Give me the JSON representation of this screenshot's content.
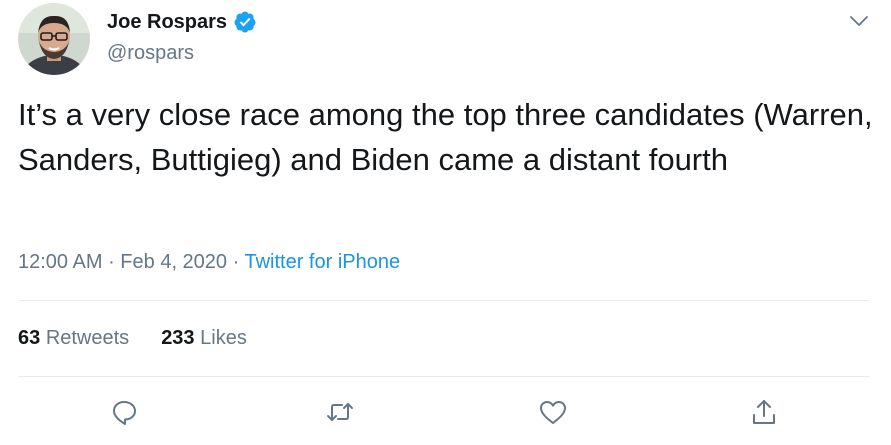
{
  "user": {
    "display_name": "Joe Rospars",
    "handle": "@rospars"
  },
  "tweet": {
    "text": "It’s a very close race among the top three candidates (Warren, Sanders, Buttigieg) and Biden came a distant fourth",
    "time": "12:00 AM",
    "date": "Feb 4, 2020",
    "separator": " · ",
    "source": "Twitter for iPhone"
  },
  "stats": {
    "retweets_count": "63",
    "retweets_label": "Retweets",
    "likes_count": "233",
    "likes_label": "Likes"
  },
  "actions": [
    "reply-icon",
    "retweet-icon",
    "like-icon",
    "share-icon"
  ],
  "colors": {
    "text": "#14171a",
    "secondary": "#657786",
    "link": "#1b95e0",
    "verified": "#1da1f2",
    "divider": "#e6ecf0"
  }
}
